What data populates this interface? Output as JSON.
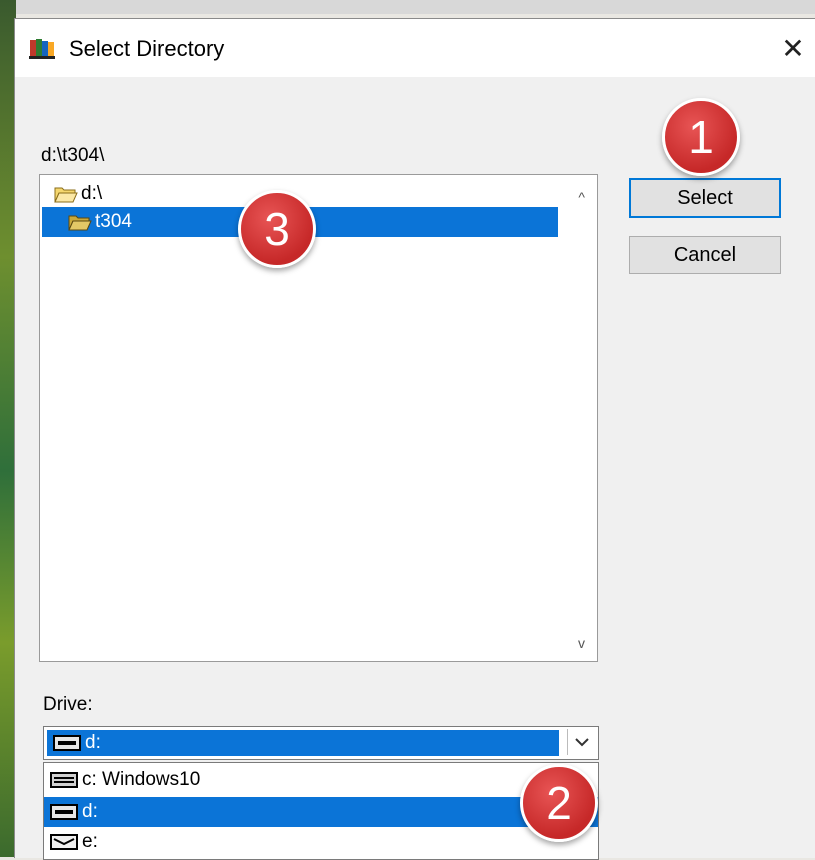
{
  "window": {
    "title": "Select Directory",
    "close_glyph": "✕"
  },
  "directory": {
    "current_path": "d:\\t304\\",
    "items": [
      {
        "label": "d:\\",
        "icon": "open-folder-icon",
        "selected": false
      },
      {
        "label": "t304",
        "icon": "open-folder-icon",
        "selected": true
      }
    ],
    "scroll_up_glyph": "^",
    "scroll_down_glyph": "v"
  },
  "buttons": {
    "select_label": "Select",
    "cancel_label": "Cancel"
  },
  "drive": {
    "label": "Drive:",
    "selected": "d:",
    "options": [
      {
        "label": "c: Windows10",
        "icon": "hard-drive-icon"
      },
      {
        "label": "d:",
        "icon": "removable-drive-icon"
      },
      {
        "label": "e:",
        "icon": "optical-drive-icon"
      }
    ]
  },
  "annotations": {
    "badge_1": "1",
    "badge_2": "2",
    "badge_3": "3"
  },
  "colors": {
    "selection": "#0b74d7",
    "badge": "#d13434",
    "select_button_border": "#0078d7"
  }
}
